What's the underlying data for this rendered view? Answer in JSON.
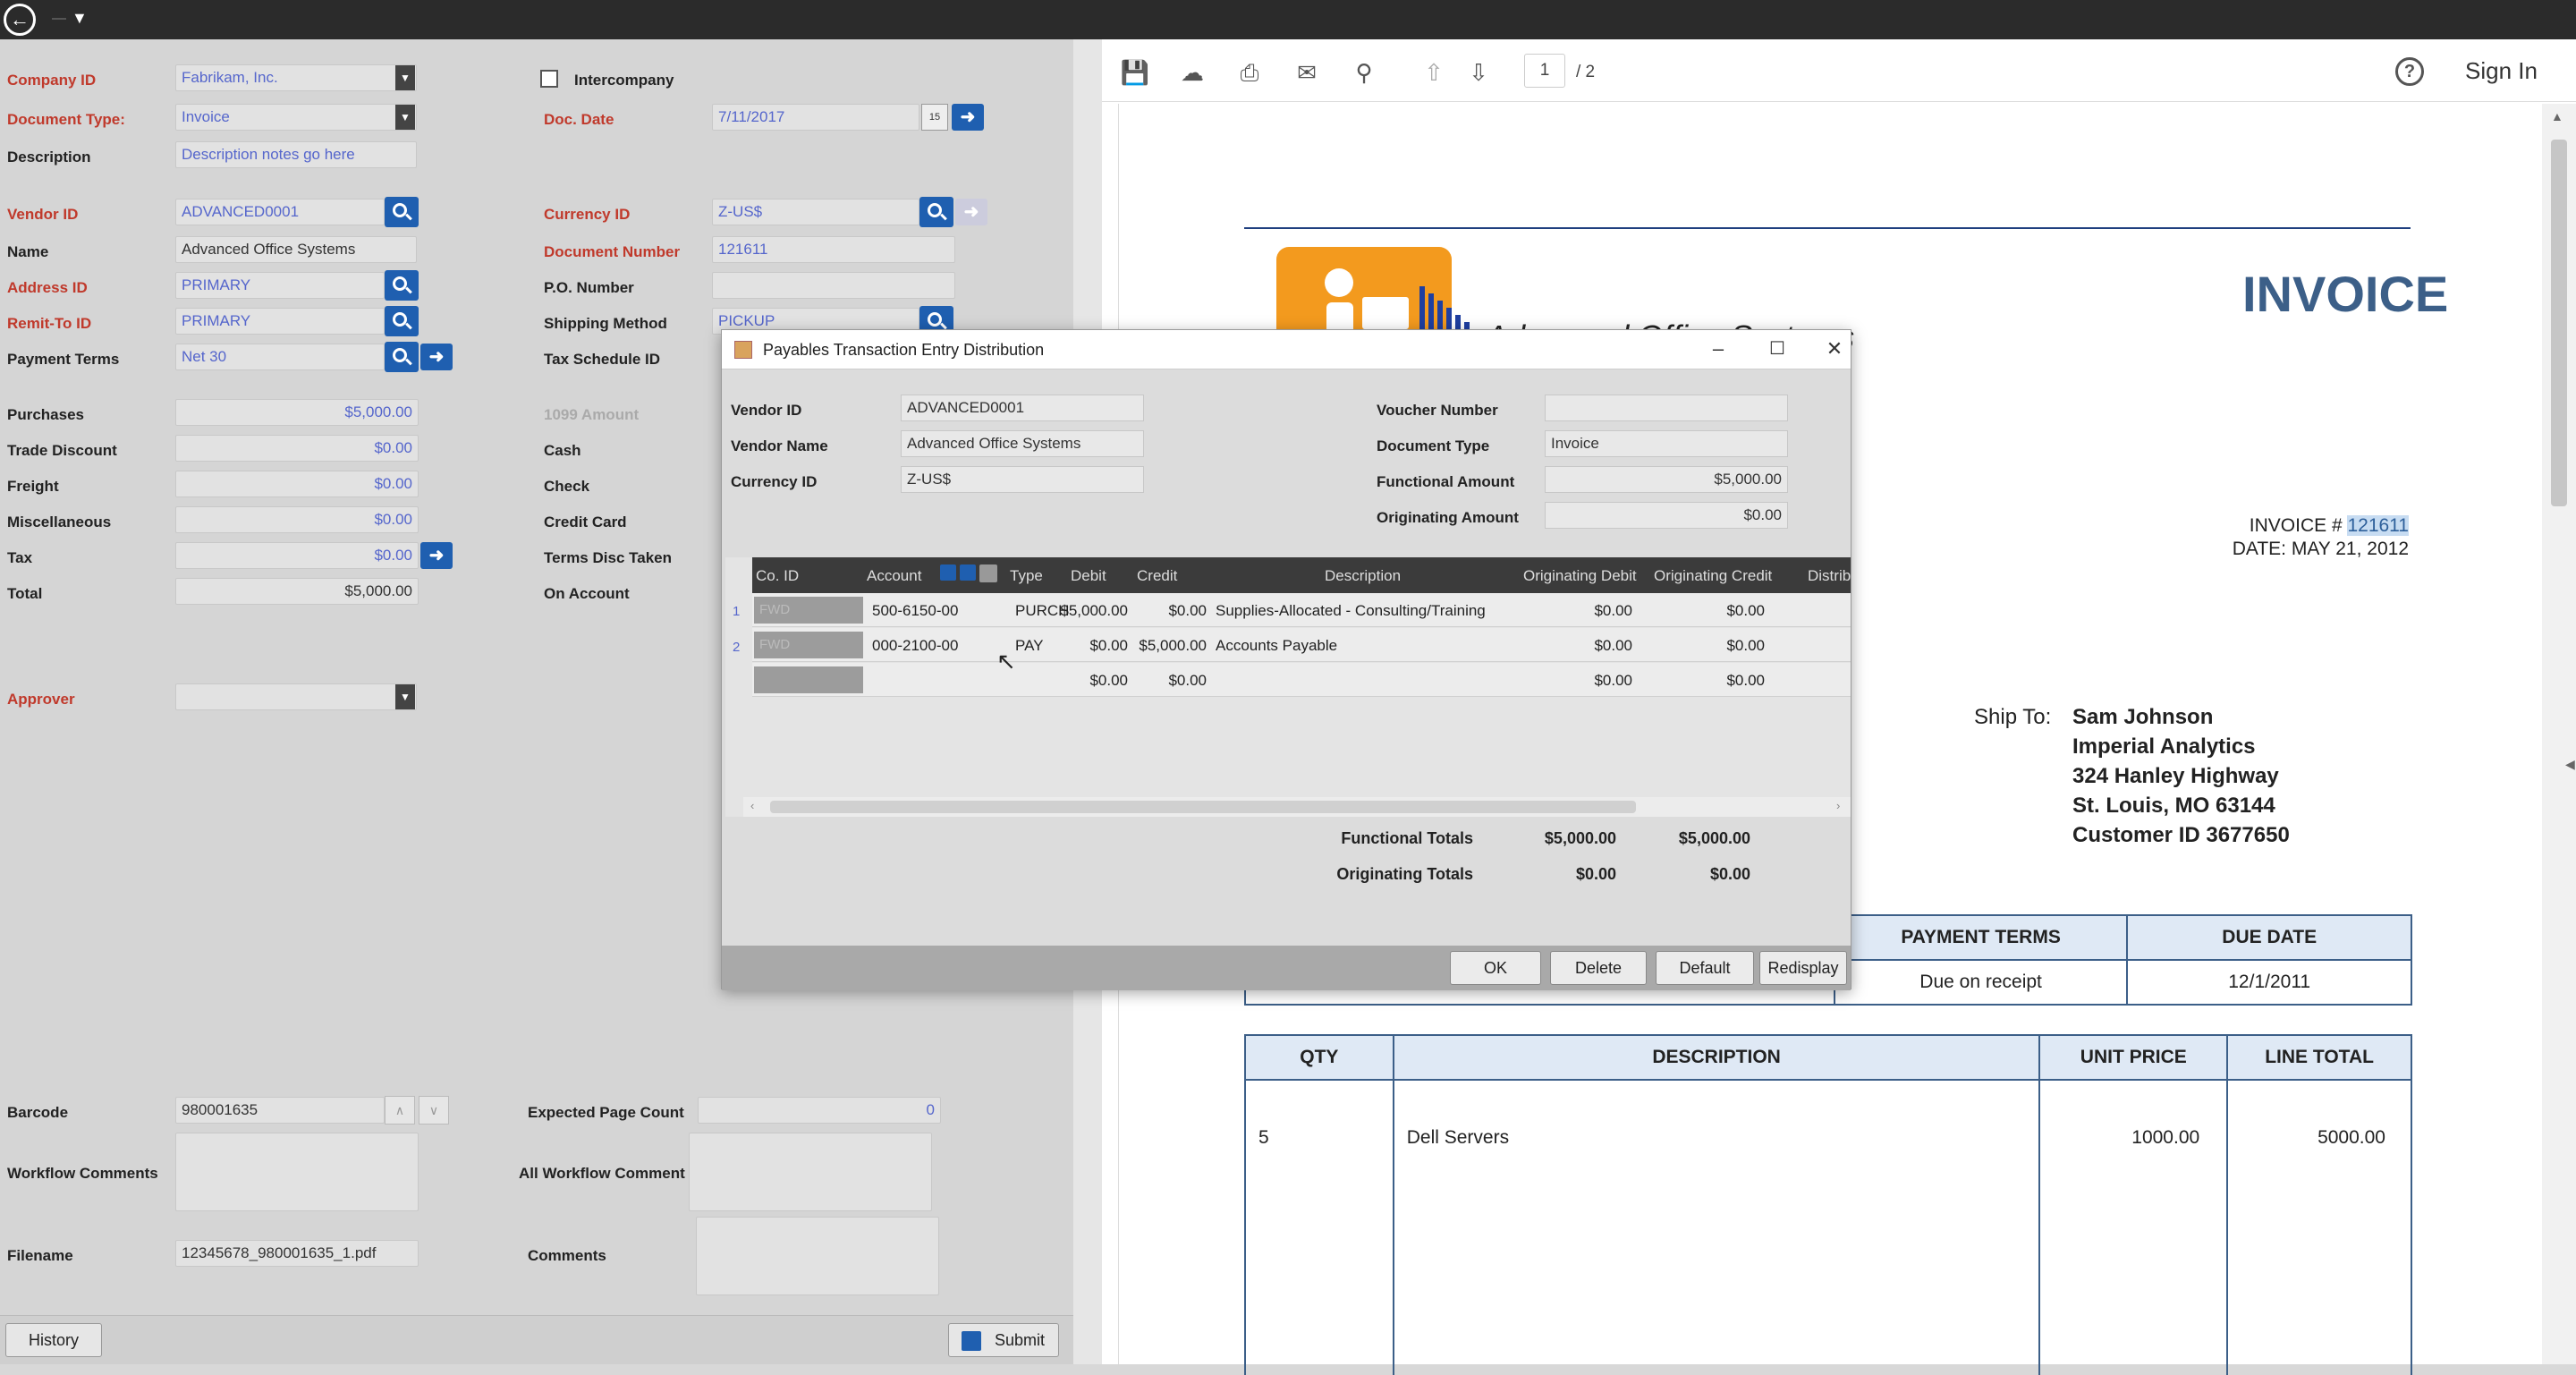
{
  "left": {
    "company_id": {
      "label": "Company ID",
      "value": "Fabrikam, Inc."
    },
    "intercompany": {
      "label": "Intercompany"
    },
    "document_type": {
      "label": "Document Type:",
      "value": "Invoice"
    },
    "doc_date": {
      "label": "Doc. Date",
      "value": "7/11/2017"
    },
    "description": {
      "label": "Description",
      "value": "Description notes go here"
    },
    "vendor_id": {
      "label": "Vendor ID",
      "value": "ADVANCED0001"
    },
    "currency_id": {
      "label": "Currency ID",
      "value": "Z-US$"
    },
    "name": {
      "label": "Name",
      "value": "Advanced Office Systems"
    },
    "document_number": {
      "label": "Document Number",
      "value": "121611"
    },
    "address_id": {
      "label": "Address ID",
      "value": "PRIMARY"
    },
    "po_number": {
      "label": "P.O. Number",
      "value": ""
    },
    "remit_to_id": {
      "label": "Remit-To ID",
      "value": "PRIMARY"
    },
    "shipping_method": {
      "label": "Shipping Method",
      "value": "PICKUP"
    },
    "payment_terms": {
      "label": "Payment Terms",
      "value": "Net 30"
    },
    "tax_schedule_id": {
      "label": "Tax Schedule ID"
    },
    "purchases": {
      "label": "Purchases",
      "value": "$5,000.00"
    },
    "amount_1099": {
      "label": "1099 Amount"
    },
    "trade_discount": {
      "label": "Trade Discount",
      "value": "$0.00"
    },
    "cash": {
      "label": "Cash"
    },
    "freight": {
      "label": "Freight",
      "value": "$0.00"
    },
    "check": {
      "label": "Check"
    },
    "miscellaneous": {
      "label": "Miscellaneous",
      "value": "$0.00"
    },
    "credit_card": {
      "label": "Credit Card"
    },
    "tax": {
      "label": "Tax",
      "value": "$0.00"
    },
    "terms_disc_taken": {
      "label": "Terms Disc Taken"
    },
    "total": {
      "label": "Total",
      "value": "$5,000.00"
    },
    "on_account": {
      "label": "On Account"
    },
    "approver": {
      "label": "Approver",
      "value": ""
    },
    "barcode": {
      "label": "Barcode",
      "value": "980001635"
    },
    "expected_page_count": {
      "label": "Expected Page Count",
      "value": "0"
    },
    "workflow_comments": {
      "label": "Workflow Comments"
    },
    "all_workflow_comments": {
      "label": "All Workflow Comment"
    },
    "filename": {
      "label": "Filename",
      "value": "12345678_980001635_1.pdf"
    },
    "comments": {
      "label": "Comments"
    },
    "history_label": "History",
    "submit_label": "Submit"
  },
  "viewer": {
    "page_current": "1",
    "page_total": "/ 2",
    "sign_in": "Sign In",
    "brand_name": "Advanced Office Systems",
    "invoice_title": "INVOICE",
    "invoice_no_label": "INVOICE # ",
    "invoice_no": "121611",
    "invoice_date": "DATE: MAY 21, 2012",
    "ship_to_label": "Ship To:",
    "ship_to": [
      "Sam Johnson",
      "Imperial Analytics",
      "324 Hanley Highway",
      "St. Louis, MO 63144",
      "Customer ID 3677650"
    ],
    "payment_terms_header": "PAYMENT TERMS",
    "due_date_header": "DUE DATE",
    "payment_terms_value": "Due on receipt",
    "due_date_value": "12/1/2011",
    "items_headers": [
      "QTY",
      "DESCRIPTION",
      "UNIT PRICE",
      "LINE TOTAL"
    ],
    "items": [
      {
        "qty": "5",
        "description": "Dell Servers",
        "unit_price": "1000.00",
        "line_total": "5000.00"
      }
    ]
  },
  "dialog": {
    "title": "Payables Transaction Entry Distribution",
    "vendor_id": {
      "label": "Vendor ID",
      "value": "ADVANCED0001"
    },
    "vendor_name": {
      "label": "Vendor Name",
      "value": "Advanced Office Systems"
    },
    "currency_id": {
      "label": "Currency ID",
      "value": "Z-US$"
    },
    "voucher_number": {
      "label": "Voucher Number",
      "value": ""
    },
    "document_type": {
      "label": "Document Type",
      "value": "Invoice"
    },
    "functional_amount": {
      "label": "Functional Amount",
      "value": "$5,000.00"
    },
    "originating_amount": {
      "label": "Originating Amount",
      "value": "$0.00"
    },
    "columns": [
      "Co. ID",
      "Account",
      "Type",
      "Debit",
      "Credit",
      "Description",
      "Originating Debit",
      "Originating Credit",
      "Distrib"
    ],
    "rows": [
      {
        "num": "1",
        "co_id": "FWD",
        "account": "500-6150-00",
        "type": "PURCH",
        "debit": "$5,000.00",
        "credit": "$0.00",
        "description": "Supplies-Allocated - Consulting/Training",
        "orig_debit": "$0.00",
        "orig_credit": "$0.00"
      },
      {
        "num": "2",
        "co_id": "FWD",
        "account": "000-2100-00",
        "type": "PAY",
        "debit": "$0.00",
        "credit": "$5,000.00",
        "description": "Accounts Payable",
        "orig_debit": "$0.00",
        "orig_credit": "$0.00"
      },
      {
        "num": "",
        "co_id": "",
        "account": "",
        "type": "",
        "debit": "$0.00",
        "credit": "$0.00",
        "description": "",
        "orig_debit": "$0.00",
        "orig_credit": "$0.00"
      }
    ],
    "functional_totals": {
      "label": "Functional Totals",
      "debit": "$5,000.00",
      "credit": "$5,000.00"
    },
    "originating_totals": {
      "label": "Originating Totals",
      "debit": "$0.00",
      "credit": "$0.00"
    },
    "buttons": {
      "ok": "OK",
      "delete": "Delete",
      "default": "Default",
      "redisplay": "Redisplay"
    }
  }
}
